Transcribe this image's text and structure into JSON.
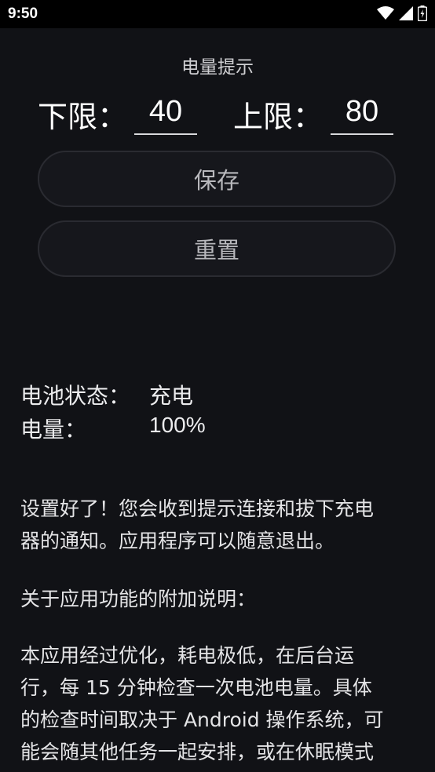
{
  "status_bar": {
    "time": "9:50",
    "icons": [
      "wifi-icon",
      "signal-icon",
      "battery-icon"
    ]
  },
  "title": "电量提示",
  "lower": {
    "label": "下限：",
    "value": "40"
  },
  "upper": {
    "label": "上限：",
    "value": "80"
  },
  "buttons": {
    "save": "保存",
    "reset": "重置"
  },
  "battery_info": {
    "status_label": "电池状态：",
    "status_value": "充电",
    "level_label": "电量：",
    "level_value": "100%"
  },
  "paragraphs": {
    "p1_line1": "设置好了！您会收到提示连接和拔下充电",
    "p1_line2": "器的通知。应用程序可以随意退出。",
    "p2": "关于应用功能的附加说明：",
    "p3_line1": "本应用经过优化，耗电极低，在后台运",
    "p3_line2": "行，每 15 分钟检查一次电池电量。具体",
    "p3_line3": "的检查时间取决于 Android 操作系统，可",
    "p3_line4": "能会随其他任务一起安排，或在休眠模式"
  },
  "colors": {
    "background": "#111216",
    "status_bar": "#000000",
    "button_bg": "#16171c",
    "text": "#e9e9ea"
  }
}
